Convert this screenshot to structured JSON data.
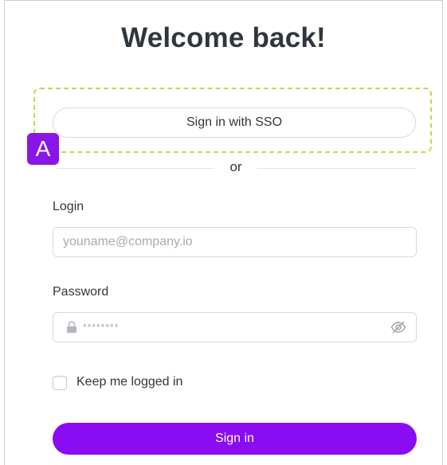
{
  "heading": "Welcome back!",
  "sso": {
    "button_label": "Sign in with SSO",
    "annotation_marker": "A",
    "highlight_color": "#b5e04f",
    "marker_color": "#8a16e6"
  },
  "divider": {
    "text": "or"
  },
  "login": {
    "label": "Login",
    "placeholder": "youname@company.io",
    "value": ""
  },
  "password": {
    "label": "Password",
    "placeholder": "********",
    "value": "",
    "leading_icon": "lock-icon",
    "trailing_icon": "eye-off-icon"
  },
  "remember": {
    "label": "Keep me logged in",
    "checked": false
  },
  "submit": {
    "label": "Sign in",
    "color": "#8a0cf2"
  }
}
